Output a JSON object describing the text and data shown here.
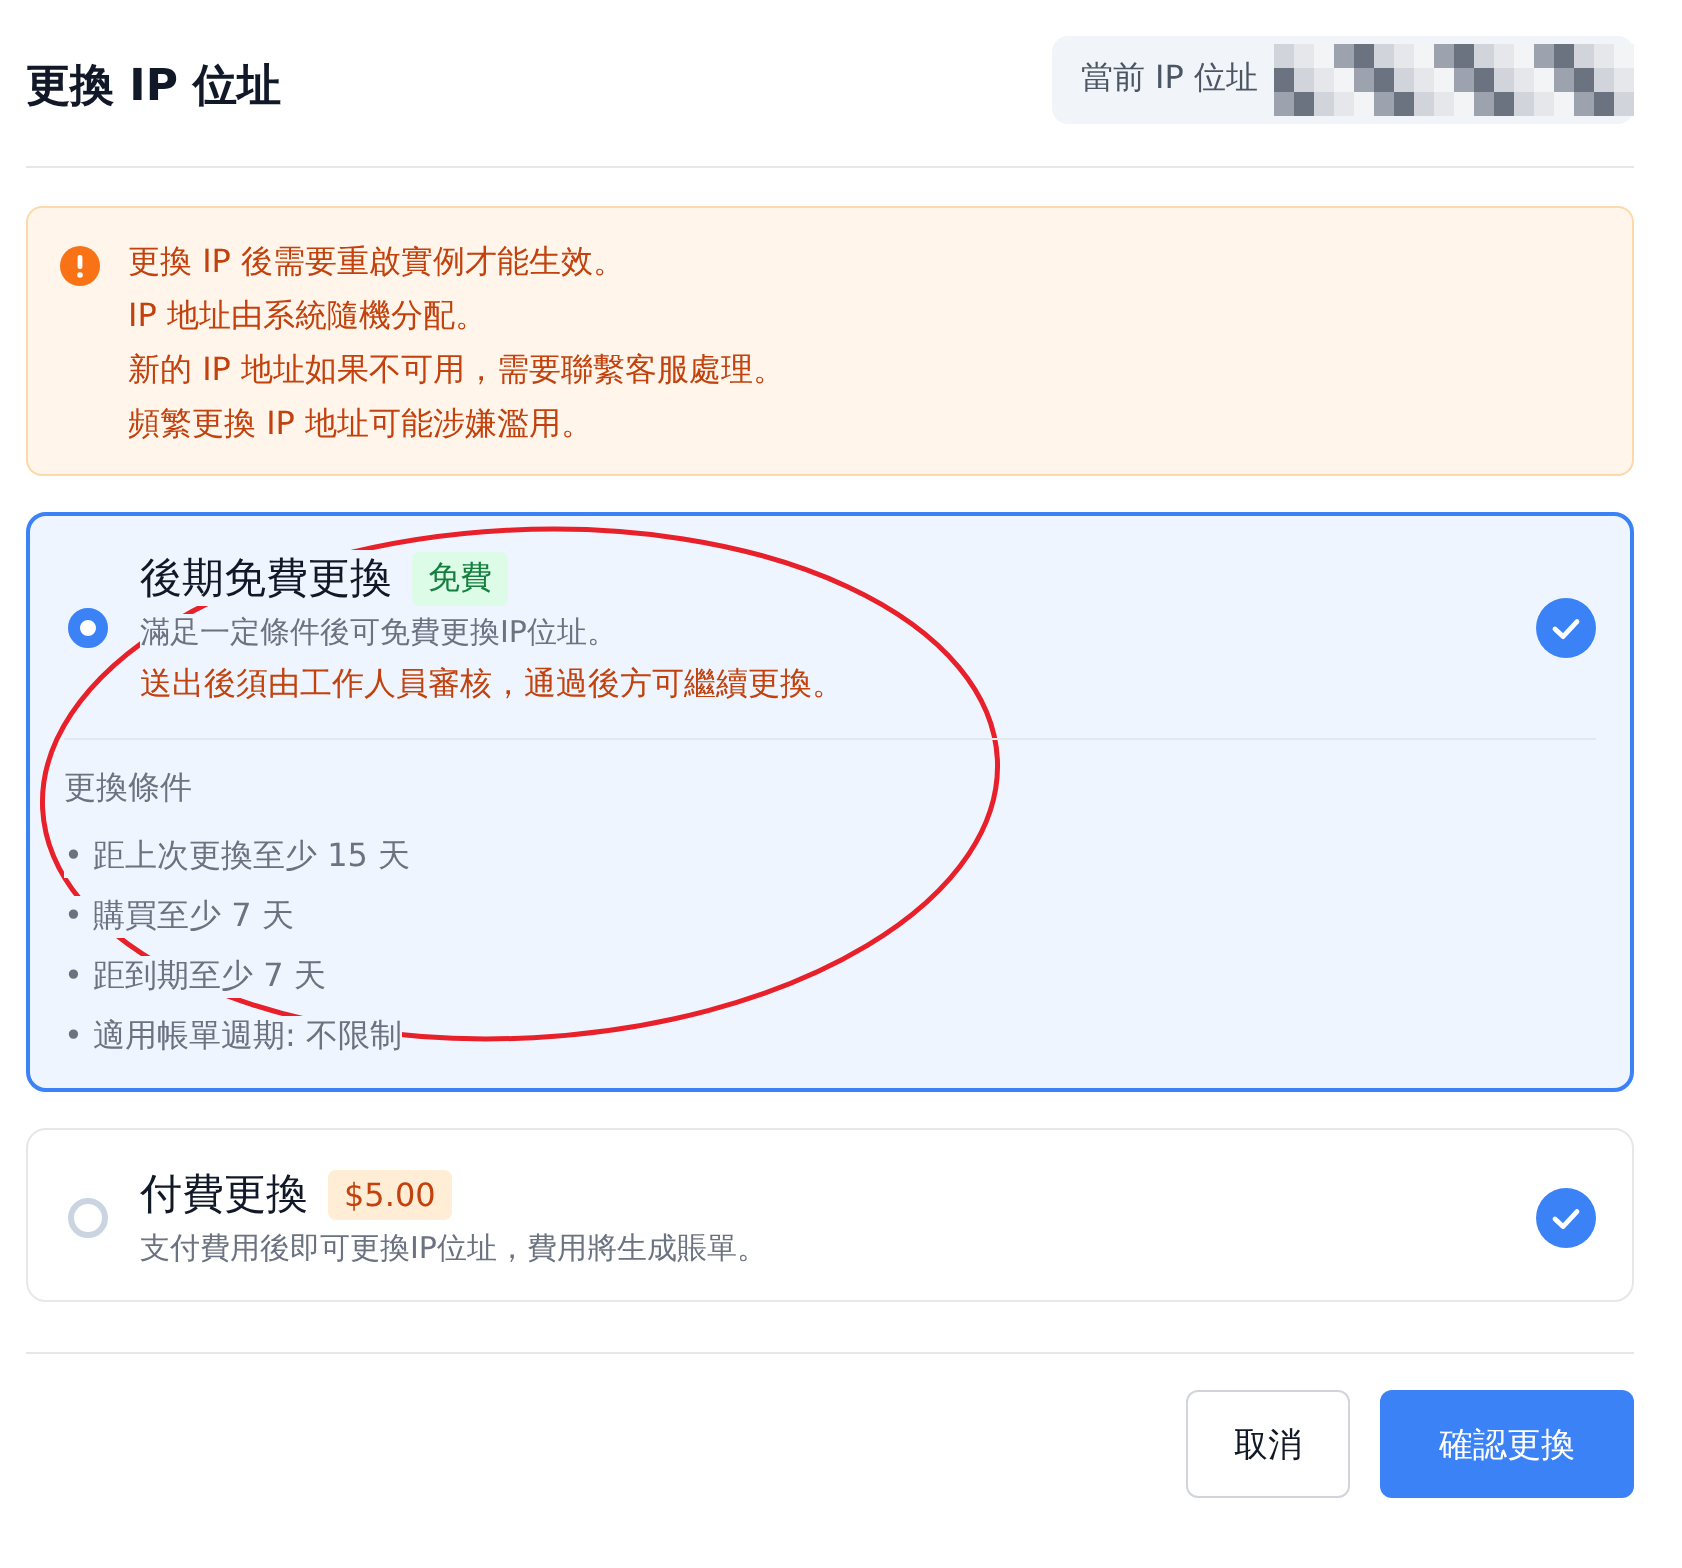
{
  "header": {
    "title": "更換 IP 位址",
    "current_ip": {
      "label": "當前 IP 位址",
      "redacted": true
    }
  },
  "alert": {
    "lines": [
      "更換 IP 後需要重啟實例才能生效。",
      "IP 地址由系統隨機分配。",
      "新的 IP 地址如果不可用，需要聯繫客服處理。",
      "頻繁更換 IP 地址可能涉嫌濫用。"
    ]
  },
  "options": [
    {
      "kind": "free",
      "title": "後期免費更換",
      "badge": "免費",
      "description": "滿足一定條件後可免費更換IP位址。",
      "note": "送出後須由工作人員審核，通過後方可繼續更換。",
      "selected": true,
      "conditions_title": "更換條件",
      "conditions": [
        "• 距上次更換至少 15 天",
        "• 購買至少 7 天",
        "• 距到期至少 7 天",
        "• 適用帳單週期: 不限制"
      ]
    },
    {
      "kind": "paid",
      "title": "付費更換",
      "badge": "$5.00",
      "description": "支付費用後即可更換IP位址，費用將生成賬單。",
      "selected": false
    }
  ],
  "buttons": [
    {
      "label": "取消",
      "kind": "secondary"
    },
    {
      "label": "確認更換",
      "kind": "primary"
    }
  ],
  "annotations": [
    {
      "kind": "ellipse",
      "color": "#e8202a"
    }
  ]
}
